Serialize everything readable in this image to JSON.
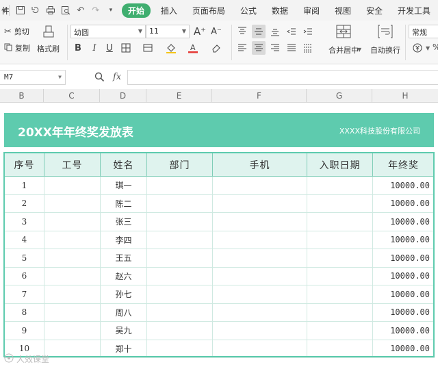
{
  "menubar": {
    "file_label": "件",
    "tabs": [
      "开始",
      "插入",
      "页面布局",
      "公式",
      "数据",
      "审阅",
      "视图",
      "安全",
      "开发工具"
    ],
    "active_tab": "开始"
  },
  "toolbar": {
    "cut": "剪切",
    "copy": "复制",
    "format_painter": "格式刷",
    "font_name": "幼圆",
    "font_size": "11",
    "merge_center": "合并居中",
    "wrap_text": "自动换行",
    "number_format": "常规"
  },
  "formula_bar": {
    "cell_ref": "M7",
    "fx_label": "fx"
  },
  "columns": [
    "B",
    "C",
    "D",
    "E",
    "F",
    "G",
    "H"
  ],
  "sheet": {
    "title": "20XX年年终奖发放表",
    "company": "XXXX科技股份有限公司",
    "headers": [
      "序号",
      "工号",
      "姓名",
      "部门",
      "手机",
      "入职日期",
      "年终奖"
    ],
    "rows": [
      {
        "idx": "1",
        "name": "琪一",
        "bonus": "10000.00"
      },
      {
        "idx": "2",
        "name": "陈二",
        "bonus": "10000.00"
      },
      {
        "idx": "3",
        "name": "张三",
        "bonus": "10000.00"
      },
      {
        "idx": "4",
        "name": "李四",
        "bonus": "10000.00"
      },
      {
        "idx": "5",
        "name": "王五",
        "bonus": "10000.00"
      },
      {
        "idx": "6",
        "name": "赵六",
        "bonus": "10000.00"
      },
      {
        "idx": "7",
        "name": "孙七",
        "bonus": "10000.00"
      },
      {
        "idx": "8",
        "name": "周八",
        "bonus": "10000.00"
      },
      {
        "idx": "9",
        "name": "吴九",
        "bonus": "10000.00"
      },
      {
        "idx": "10",
        "name": "郑十",
        "bonus": "10000.00"
      }
    ]
  },
  "watermark": "人效课堂",
  "colors": {
    "accent": "#3fae6f",
    "banner": "#5ecbae",
    "header_fill": "#dff3ee"
  }
}
